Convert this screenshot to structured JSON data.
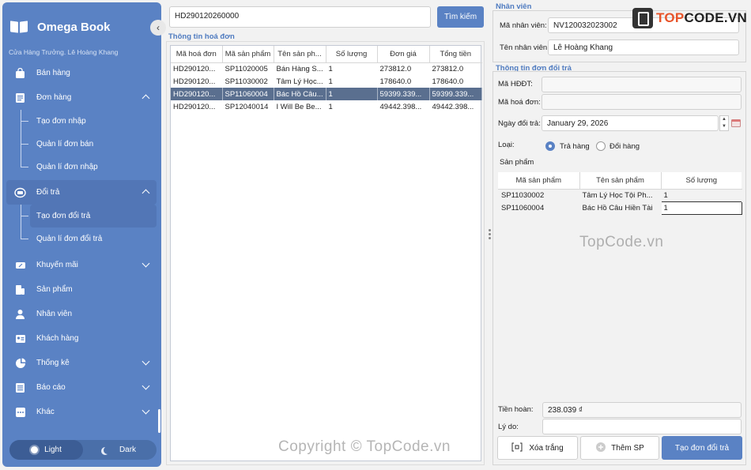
{
  "app": {
    "title": "Omega Book",
    "store_line": "Cửa Hàng Trưởng. Lê Hoàng Khang"
  },
  "sidebar": {
    "items": [
      {
        "label": "Bán hàng",
        "icon": "bag-icon"
      },
      {
        "label": "Đơn hàng",
        "icon": "list-icon",
        "expanded": true,
        "children": [
          "Tạo đơn nhập",
          "Quản lí đơn bán",
          "Quản lí đơn nhập"
        ]
      },
      {
        "label": "Đổi trả",
        "icon": "return-icon",
        "expanded": true,
        "children": [
          "Tạo đơn đổi trả",
          "Quản lí đơn đổi trả"
        ]
      },
      {
        "label": "Khuyến mãi",
        "icon": "ticket-icon"
      },
      {
        "label": "Sản phẩm",
        "icon": "box-icon"
      },
      {
        "label": "Nhân viên",
        "icon": "person-icon"
      },
      {
        "label": "Khách hàng",
        "icon": "id-card-icon"
      },
      {
        "label": "Thống kê",
        "icon": "pie-icon"
      },
      {
        "label": "Báo cáo",
        "icon": "report-icon"
      },
      {
        "label": "Khác",
        "icon": "more-icon"
      }
    ],
    "theme": {
      "light": "Light",
      "dark": "Dark",
      "selected": "Light"
    }
  },
  "search": {
    "value": "HD290120260000",
    "button": "Tìm kiếm"
  },
  "invoice": {
    "title": "Thông tin hoá đơn",
    "columns": [
      "Mã hoá đơn",
      "Mã sản phẩm",
      "Tên sản ph...",
      "Số lượng",
      "Đơn giá",
      "Tổng tiền"
    ],
    "rows": [
      [
        "HD290120...",
        "SP11020005",
        "Bán Hàng S...",
        "1",
        "273812.0",
        "273812.0"
      ],
      [
        "HD290120...",
        "SP11030002",
        "Tâm Lý Học...",
        "1",
        "178640.0",
        "178640.0"
      ],
      [
        "HD290120...",
        "SP11060004",
        "Bác Hồ Câu...",
        "1",
        "59399.339...",
        "59399.339..."
      ],
      [
        "HD290120...",
        "SP12040014",
        "I Will Be Be...",
        "1",
        "49442.398...",
        "49442.398..."
      ]
    ],
    "selected_row": 2
  },
  "employee": {
    "title": "Nhân viên",
    "id_label": "Mã nhân viên:",
    "id_value": "NV120032023002",
    "name_label": "Tên nhân viên:",
    "name_value": "Lê Hoàng Khang"
  },
  "return_info": {
    "title": "Thông tin đơn đổi trả",
    "hddt_label": "Mã HĐĐT:",
    "hddt_value": "",
    "invoice_label": "Mã hoá đơn:",
    "invoice_value": "",
    "date_label": "Ngày đổi trả:",
    "date_value": "January 29, 2026",
    "type_label": "Loại:",
    "type_return": "Trả hàng",
    "type_exchange": "Đổi hàng",
    "type_selected": "Trả hàng",
    "products_label": "Sản phẩm",
    "columns": [
      "Mã sản phẩm",
      "Tên sản phẩm",
      "Số lượng"
    ],
    "rows": [
      [
        "SP11030002",
        "Tâm Lý Học Tội Ph...",
        "1"
      ],
      [
        "SP11060004",
        "Bác Hồ Câu Hiền Tài",
        "1"
      ]
    ],
    "refund_label": "Tiền hoàn:",
    "refund_value": "238.039 ₫",
    "reason_label": "Lý do:",
    "reason_value": ""
  },
  "actions": {
    "clear": "Xóa trắng",
    "add": "Thêm SP",
    "create": "Tạo đơn đổi trả"
  },
  "watermarks": {
    "logo_prefix": "TOP",
    "logo_suffix": "CODE.VN",
    "center": "TopCode.vn",
    "copyright": "Copyright © TopCode.vn"
  },
  "colors": {
    "sidebar": "#5a82c4",
    "accent": "#4f7bc0",
    "selected_row": "#5a6f8f"
  }
}
